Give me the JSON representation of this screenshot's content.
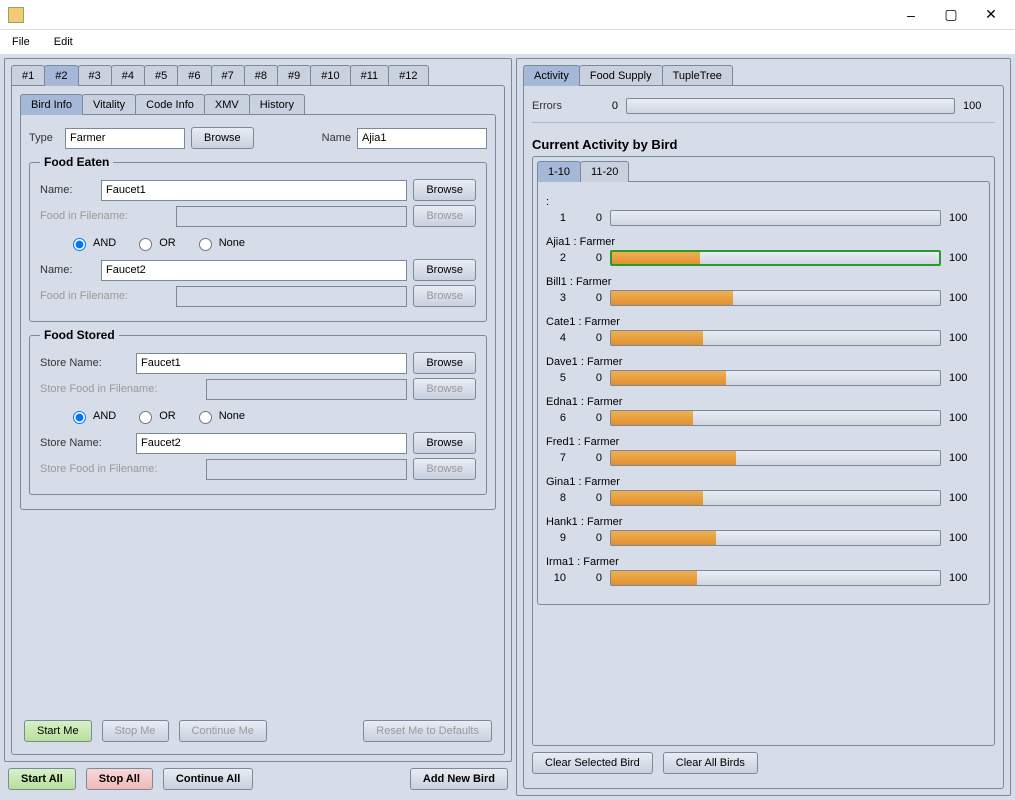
{
  "window": {
    "minimize": "–",
    "maximize": "▢",
    "close": "✕"
  },
  "menu": {
    "file": "File",
    "edit": "Edit"
  },
  "topTabs": [
    "#1",
    "#2",
    "#3",
    "#4",
    "#5",
    "#6",
    "#7",
    "#8",
    "#9",
    "#10",
    "#11",
    "#12"
  ],
  "topTabActive": 1,
  "leftTabs": [
    "Bird Info",
    "Vitality",
    "Code Info",
    "XMV",
    "History"
  ],
  "leftTabActive": 0,
  "birdInfo": {
    "typeLabel": "Type",
    "typeValue": "Farmer",
    "browse": "Browse",
    "nameLabel": "Name",
    "nameValue": "Ajia1"
  },
  "foodEaten": {
    "legend": "Food Eaten",
    "name1Label": "Name:",
    "name1Value": "Faucet1",
    "browse1": "Browse",
    "file1Label": "Food in Filename:",
    "file1Value": "",
    "browseFile1": "Browse",
    "radios": {
      "and": "AND",
      "or": "OR",
      "none": "None"
    },
    "radioSel": "and",
    "name2Label": "Name:",
    "name2Value": "Faucet2",
    "browse2": "Browse",
    "file2Label": "Food in Filename:",
    "file2Value": "",
    "browseFile2": "Browse"
  },
  "foodStored": {
    "legend": "Food Stored",
    "name1Label": "Store Name:",
    "name1Value": "Faucet1",
    "browse1": "Browse",
    "file1Label": "Store Food in Filename:",
    "file1Value": "",
    "browseFile1": "Browse",
    "radios": {
      "and": "AND",
      "or": "OR",
      "none": "None"
    },
    "radioSel": "and",
    "name2Label": "Store Name:",
    "name2Value": "Faucet2",
    "browse2": "Browse",
    "file2Label": "Store Food in Filename:",
    "file2Value": "",
    "browseFile2": "Browse"
  },
  "birdBtns": {
    "start": "Start Me",
    "stop": "Stop Me",
    "cont": "Continue Me",
    "reset": "Reset Me to Defaults"
  },
  "globalBtns": {
    "startAll": "Start All",
    "stopAll": "Stop All",
    "contAll": "Continue All",
    "addNew": "Add New Bird"
  },
  "rightTabs": [
    "Activity",
    "Food Supply",
    "TupleTree"
  ],
  "rightTabActive": 0,
  "errors": {
    "label": "Errors",
    "min": "0",
    "max": "100"
  },
  "activityTitle": "Current Activity by Bird",
  "rangeTabs": [
    "1-10",
    "11-20"
  ],
  "rangeActive": 0,
  "dotLabel": ":",
  "birds": [
    {
      "idx": "1",
      "min": "0",
      "max": "100",
      "name": "",
      "pct": 0,
      "hl": false
    },
    {
      "idx": "2",
      "min": "0",
      "max": "100",
      "name": "Ajia1 : Farmer",
      "pct": 27,
      "hl": true
    },
    {
      "idx": "3",
      "min": "0",
      "max": "100",
      "name": "Bill1 : Farmer",
      "pct": 37,
      "hl": false
    },
    {
      "idx": "4",
      "min": "0",
      "max": "100",
      "name": "Cate1 : Farmer",
      "pct": 28,
      "hl": false
    },
    {
      "idx": "5",
      "min": "0",
      "max": "100",
      "name": "Dave1 : Farmer",
      "pct": 35,
      "hl": false
    },
    {
      "idx": "6",
      "min": "0",
      "max": "100",
      "name": "Edna1 : Farmer",
      "pct": 25,
      "hl": false
    },
    {
      "idx": "7",
      "min": "0",
      "max": "100",
      "name": "Fred1 : Farmer",
      "pct": 38,
      "hl": false
    },
    {
      "idx": "8",
      "min": "0",
      "max": "100",
      "name": "Gina1 : Farmer",
      "pct": 28,
      "hl": false
    },
    {
      "idx": "9",
      "min": "0",
      "max": "100",
      "name": "Hank1 : Farmer",
      "pct": 32,
      "hl": false
    },
    {
      "idx": "10",
      "min": "0",
      "max": "100",
      "name": "Irma1 : Farmer",
      "pct": 26,
      "hl": false
    }
  ],
  "actBtns": {
    "clearSel": "Clear Selected Bird",
    "clearAll": "Clear All Birds"
  }
}
